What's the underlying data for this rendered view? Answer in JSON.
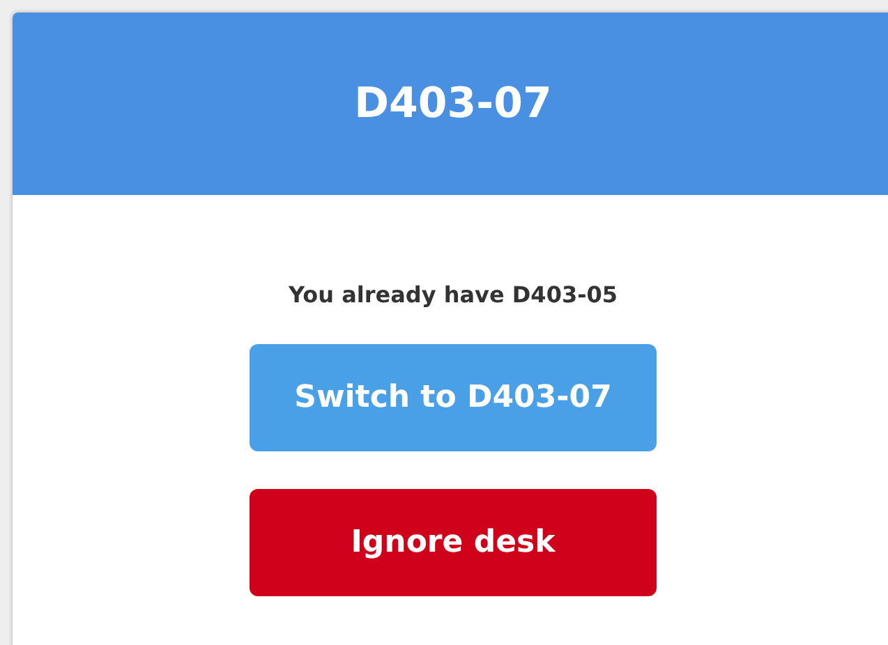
{
  "dialog": {
    "title": "D403-07",
    "message": "You already have D403-05",
    "buttons": [
      {
        "label": "Switch to D403-07",
        "kind": "primary"
      },
      {
        "label": "Ignore desk",
        "kind": "danger"
      }
    ]
  }
}
